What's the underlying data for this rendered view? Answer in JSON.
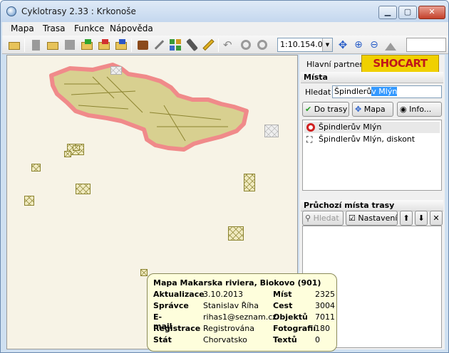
{
  "window": {
    "title": "Cyklotrasy 2.33 : Krkonoše",
    "controls": {
      "minimize": "▁",
      "maximize": "▢",
      "close": "✕"
    }
  },
  "menu": [
    "Mapa",
    "Trasa",
    "Funkce",
    "Nápověda"
  ],
  "toolbar": {
    "scale_value": "1:10.154.00",
    "icons": [
      "open-folder-icon",
      "page-icon",
      "folder-icon",
      "save-disk-icon",
      "export-green-icon",
      "export-red-icon",
      "import-blue-icon",
      "book-icon",
      "wrench-icon",
      "tiles-grid-icon",
      "gps-device-icon",
      "ruler-icon",
      "undo-icon",
      "circle-icon",
      "stop-circle-icon",
      "move-icon",
      "zoom-in-icon",
      "zoom-out-icon",
      "terrain-icon"
    ]
  },
  "partner": {
    "label": "Hlavní partner",
    "logo_text": "SHOCART",
    "logo_color": "#c0181a",
    "logo_bg": "#f0d000"
  },
  "places": {
    "header": "Místa",
    "search_label": "Hledat",
    "search_value_plain": "Špindlerů",
    "search_value_selected": "v Mlýn",
    "buttons": {
      "to_route": "Do trasy",
      "map": "Mapa",
      "info": "Info..."
    },
    "results": [
      {
        "label": "Špindlerův Mlýn",
        "icon": "target-marker-icon"
      },
      {
        "label": "Špindlerův Mlýn, diskont",
        "icon": "crossed-marker-icon"
      }
    ]
  },
  "route_points": {
    "header": "Průchozí místa trasy",
    "buttons": {
      "find": "Hledat",
      "settings": "Nastavení"
    }
  },
  "tooltip": {
    "title": "Mapa Makarska riviera, Biokovo (901)",
    "rows": [
      {
        "label": "Aktualizace",
        "value": "3.10.2013",
        "label2": "Míst",
        "value2": "2325"
      },
      {
        "label": "Správce",
        "value": "Stanislav Říha",
        "label2": "Cest",
        "value2": "3004"
      },
      {
        "label": "E-mail",
        "value": "rihas1@seznam.cz",
        "label2": "Objektů",
        "value2": "7011"
      },
      {
        "label": "Registrace",
        "value": "Registrována",
        "label2": "Fotografií",
        "value2": "180"
      },
      {
        "label": "Stát",
        "value": "Chorvatsko",
        "label2": "Textů",
        "value2": "0"
      }
    ]
  },
  "colors": {
    "accent": "#3399ff",
    "map_outline": "#f08a8a",
    "tile": "#8c8430"
  }
}
